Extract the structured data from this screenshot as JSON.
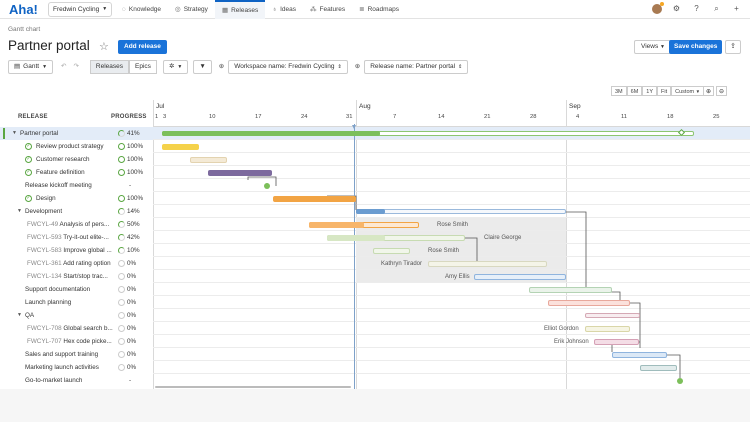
{
  "app": {
    "logo": "Aha!",
    "workspace": "Fredwin Cycling",
    "nav": [
      {
        "label": "Knowledge",
        "icon": "lightbulb-icon"
      },
      {
        "label": "Strategy",
        "icon": "target-icon"
      },
      {
        "label": "Releases",
        "icon": "calendar-icon",
        "active": true
      },
      {
        "label": "Ideas",
        "icon": "idea-icon"
      },
      {
        "label": "Features",
        "icon": "grid-icon"
      },
      {
        "label": "Roadmaps",
        "icon": "roadmap-icon"
      }
    ]
  },
  "header": {
    "breadcrumb": "Gantt chart",
    "title": "Partner portal",
    "add_release": "Add release",
    "views": "Views",
    "save": "Save changes"
  },
  "toolbar": {
    "view_mode": "Gantt",
    "seg_releases": "Releases",
    "seg_epics": "Epics",
    "filter_workspace": "Workspace name: Fredwin Cycling",
    "filter_release": "Release name: Partner portal"
  },
  "timeline": {
    "zoom": [
      "3M",
      "6M",
      "1Y",
      "Fit",
      "Custom"
    ],
    "months": [
      "Jul",
      "Aug",
      "Sep"
    ],
    "days": [
      "1",
      "3",
      "10",
      "17",
      "24",
      "31",
      "7",
      "14",
      "21",
      "28",
      "4",
      "11",
      "18",
      "25"
    ]
  },
  "grid": {
    "col_release": "RELEASE",
    "col_progress": "PROGRESS",
    "rows": [
      {
        "code": "",
        "name": "Partner portal",
        "progress": "41%"
      },
      {
        "code": "",
        "name": "Review product strategy",
        "progress": "100%"
      },
      {
        "code": "",
        "name": "Customer research",
        "progress": "100%"
      },
      {
        "code": "",
        "name": "Feature definition",
        "progress": "100%"
      },
      {
        "code": "",
        "name": "Release kickoff meeting",
        "progress": "-"
      },
      {
        "code": "",
        "name": "Design",
        "progress": "100%"
      },
      {
        "code": "",
        "name": "Development",
        "progress": "14%"
      },
      {
        "code": "FWCYL-49",
        "name": "Analysis of pers...",
        "progress": "50%"
      },
      {
        "code": "FWCYL-593",
        "name": "Try-it-out elite-...",
        "progress": "42%"
      },
      {
        "code": "FWCYL-583",
        "name": "Improve global ...",
        "progress": "10%"
      },
      {
        "code": "FWCYL-361",
        "name": "Add rating option",
        "progress": "0%"
      },
      {
        "code": "FWCYL-134",
        "name": "Start/stop trac...",
        "progress": "0%"
      },
      {
        "code": "",
        "name": "Support documentation",
        "progress": "0%"
      },
      {
        "code": "",
        "name": "Launch planning",
        "progress": "0%"
      },
      {
        "code": "",
        "name": "QA",
        "progress": "0%"
      },
      {
        "code": "FWCYL-708",
        "name": "Global search b...",
        "progress": "0%"
      },
      {
        "code": "FWCYL-707",
        "name": "Hex code picke...",
        "progress": "0%"
      },
      {
        "code": "",
        "name": "Sales and support training",
        "progress": "0%"
      },
      {
        "code": "",
        "name": "Marketing launch activities",
        "progress": "0%"
      },
      {
        "code": "",
        "name": "Go-to-market launch",
        "progress": "-"
      }
    ]
  },
  "assignees": {
    "a1": "Rose Smith",
    "a2": "Claire George",
    "a3": "Rose Smith",
    "a4": "Kathryn Tirador",
    "a5": "Amy Ellis",
    "a6": "Elliot Gordon",
    "a7": "Erik Johnson"
  },
  "colors": {
    "brand": "#0f63c4",
    "green": "#7cbf5a",
    "yellow": "#f5d24a",
    "purple": "#7d6a9e",
    "orange": "#f2a444",
    "blue": "#6b9cd0"
  }
}
